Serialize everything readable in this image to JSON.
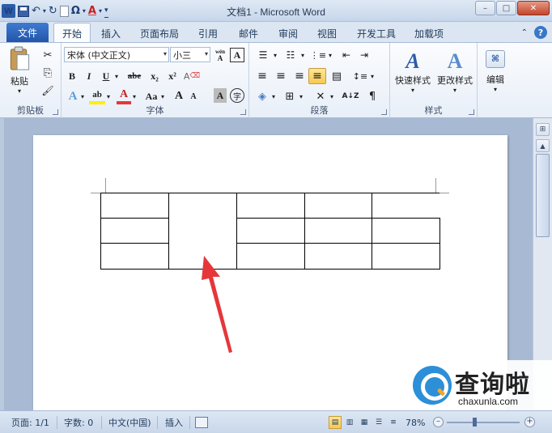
{
  "window": {
    "title": "文档1 - Microsoft Word",
    "minimize": "–",
    "maximize": "□",
    "close": "✕"
  },
  "quick_access": {
    "app_letter": "W",
    "undo": "↶",
    "redo": "↻",
    "symbol": "Ω",
    "font_color": "A",
    "more": "▾"
  },
  "tabs": {
    "file": "文件",
    "items": [
      "开始",
      "插入",
      "页面布局",
      "引用",
      "邮件",
      "审阅",
      "视图",
      "开发工具",
      "加载项"
    ],
    "active": "开始",
    "help": "?",
    "collapse": "⌃"
  },
  "ribbon": {
    "clipboard": {
      "label": "剪贴板",
      "paste": "粘贴",
      "cut": "✂",
      "copy": "⎘",
      "format_painter": "🖌"
    },
    "font": {
      "label": "字体",
      "font_name": "宋体 (中文正文)",
      "font_size": "小三",
      "grow": "A",
      "shrink": "A",
      "bold": "B",
      "italic": "I",
      "underline": "U",
      "strike": "abe",
      "subscript": "x₂",
      "superscript": "x²",
      "text_effect": "A",
      "highlight": "ab",
      "font_color": "A",
      "change_case": "Aa",
      "grow_font": "A",
      "shrink_font": "A",
      "char_shading": "A",
      "enclose": "字",
      "phonetic": "wén",
      "border_char": "A",
      "clear_format": "A"
    },
    "paragraph": {
      "label": "段落",
      "bullets": "☰",
      "numbering": "☷",
      "multilevel": "⋮≡",
      "decrease_indent": "⇤",
      "increase_indent": "⇥",
      "align_left": "≡",
      "center": "≡",
      "align_right": "≡",
      "justify": "≡",
      "distributed": "▤",
      "line_spacing": "↕≡",
      "shading": "◈",
      "borders": "⊞",
      "chinese_layout": "✕",
      "sort": "A↓Z",
      "show_marks": "¶"
    },
    "styles": {
      "label": "样式",
      "quick_styles": "快速样式",
      "change_styles": "更改样式"
    },
    "editing": {
      "label": "编辑",
      "find": "编辑"
    }
  },
  "status": {
    "page": "页面: 1/1",
    "words": "字数: 0",
    "language": "中文(中国)",
    "mode": "插入",
    "zoom": "78%",
    "zoom_out": "–",
    "zoom_in": "+"
  },
  "watermark": {
    "name": "查询啦",
    "domain": "chaxunla.com"
  },
  "colors": {
    "accent": "#2b5ca8",
    "arrow": "#e5373a",
    "highlight_active": "#f8c94d"
  }
}
